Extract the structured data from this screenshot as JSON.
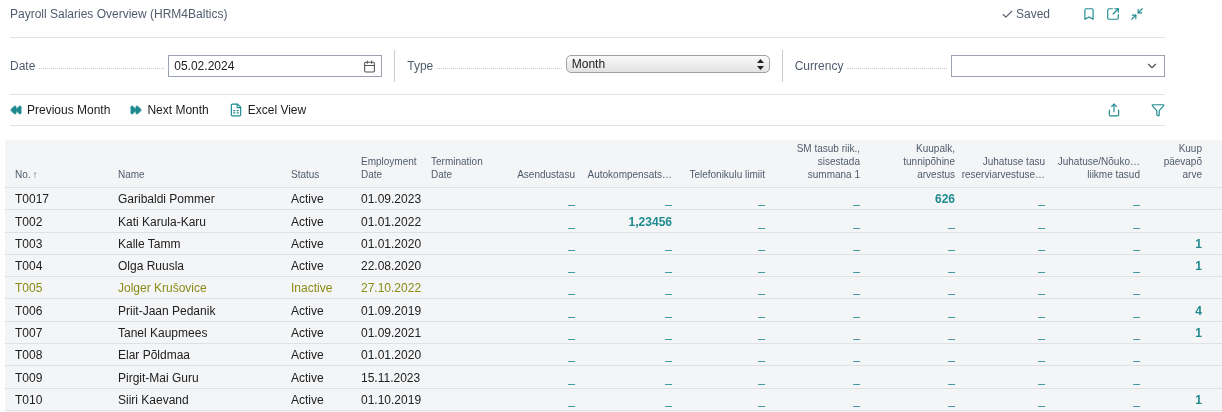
{
  "page": {
    "title": "Payroll Salaries Overview (HRM4Baltics)",
    "status": "Saved"
  },
  "filters": [
    {
      "kind": "date",
      "label": "Date",
      "value": "05.02.2024"
    },
    {
      "kind": "select",
      "label": "Type",
      "value": "Month"
    },
    {
      "kind": "dropdown",
      "label": "Currency"
    }
  ],
  "actions": [
    {
      "kind": "previous",
      "label": "Previous Month"
    },
    {
      "kind": "next",
      "label": "Next Month"
    },
    {
      "kind": "excel",
      "label": "Excel View"
    }
  ],
  "table": {
    "columns": [
      {
        "label": "No.",
        "kind": "text",
        "sort_indicator": "↑"
      },
      {
        "label": "Name",
        "kind": "text"
      },
      {
        "label": "Status",
        "kind": "text"
      },
      {
        "label": "Employment\nDate",
        "kind": "text"
      },
      {
        "label": "Termination\nDate",
        "kind": "text"
      },
      {
        "label": "Asendustasu",
        "kind": "number"
      },
      {
        "label": "Autokompensats…",
        "kind": "number"
      },
      {
        "label": "Telefonikulu limiit",
        "kind": "number"
      },
      {
        "label": "SM tasub riik.,\nsisestada\nsummana 1",
        "kind": "number"
      },
      {
        "label": "Kuupalk,\ntunnipõhine\narvestus",
        "kind": "number"
      },
      {
        "label": "Juhatuse tasu\nreserviarvestuse…",
        "kind": "number"
      },
      {
        "label": "Juhatuse/Nõuko…\nliikme tasud",
        "kind": "number"
      },
      {
        "label": "Kuup\npäevapõ\narve",
        "kind": "number"
      }
    ],
    "rows": [
      {
        "no": "T0017",
        "name": "Garibaldi Pommer",
        "status": "Active",
        "employment_date": "01.09.2023",
        "inactive": false,
        "values": [
          "_",
          "_",
          "_",
          "_",
          "626",
          "_",
          "_"
        ]
      },
      {
        "no": "T002",
        "name": "Kati Karula-Karu",
        "status": "Active",
        "employment_date": "01.01.2022",
        "inactive": false,
        "values": [
          "_",
          "1,23456",
          "_",
          "_",
          "_",
          "_",
          "_"
        ]
      },
      {
        "no": "T003",
        "name": "Kalle Tamm",
        "status": "Active",
        "employment_date": "01.01.2020",
        "inactive": false,
        "values": [
          "_",
          "_",
          "_",
          "_",
          "_",
          "_",
          "_"
        ],
        "kuup_value": "1"
      },
      {
        "no": "T004",
        "name": "Olga Ruusla",
        "status": "Active",
        "employment_date": "22.08.2020",
        "inactive": false,
        "values": [
          "_",
          "_",
          "_",
          "_",
          "_",
          "_",
          "_"
        ],
        "kuup_value": "1"
      },
      {
        "no": "T005",
        "name": "Jolger Krušovice",
        "status": "Inactive",
        "employment_date": "27.10.2022",
        "inactive": true,
        "values": [
          "_",
          "_",
          "_",
          "_",
          "_",
          "_",
          "_"
        ]
      },
      {
        "no": "T006",
        "name": "Priit-Jaan Pedanik",
        "status": "Active",
        "employment_date": "01.09.2019",
        "inactive": false,
        "values": [
          "_",
          "_",
          "_",
          "_",
          "_",
          "_",
          "_"
        ],
        "kuup_value": "4"
      },
      {
        "no": "T007",
        "name": "Tanel Kaupmees",
        "status": "Active",
        "employment_date": "01.09.2021",
        "inactive": false,
        "values": [
          "_",
          "_",
          "_",
          "_",
          "_",
          "_",
          "_"
        ],
        "kuup_value": "1"
      },
      {
        "no": "T008",
        "name": "Elar Põldmaa",
        "status": "Active",
        "employment_date": "01.01.2020",
        "inactive": false,
        "values": [
          "_",
          "_",
          "_",
          "_",
          "_",
          "_",
          "_"
        ]
      },
      {
        "no": "T009",
        "name": "Pirgit-Mai Guru",
        "status": "Active",
        "employment_date": "15.11.2023",
        "inactive": false,
        "values": [
          "_",
          "_",
          "_",
          "_",
          "_",
          "_",
          "_"
        ]
      },
      {
        "no": "T010",
        "name": "Siiri Kaevand",
        "status": "Active",
        "employment_date": "01.10.2019",
        "inactive": false,
        "values": [
          "_",
          "_",
          "_",
          "_",
          "_",
          "_",
          "_"
        ],
        "kuup_value": "1"
      }
    ]
  }
}
